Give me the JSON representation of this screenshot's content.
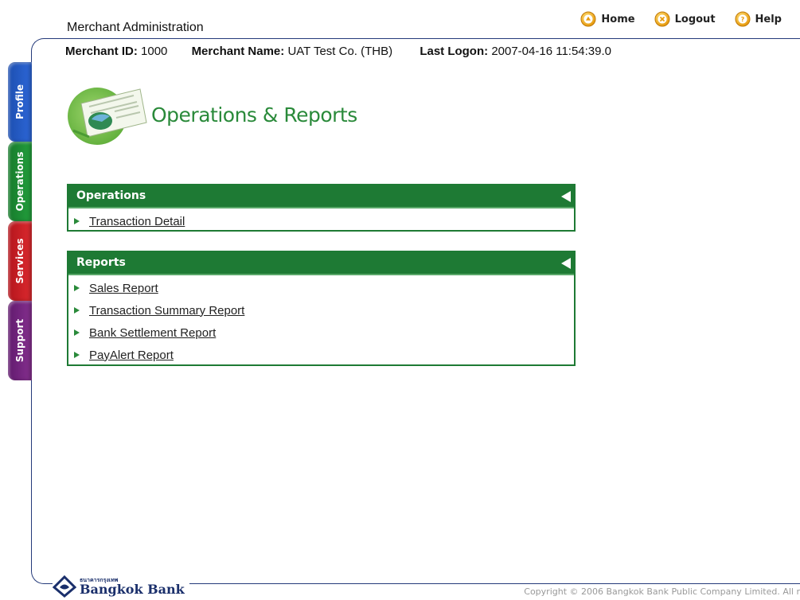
{
  "header": {
    "title": "Merchant Administration",
    "nav": [
      {
        "label": "Home",
        "icon": "home-icon"
      },
      {
        "label": "Logout",
        "icon": "logout-icon"
      },
      {
        "label": "Help",
        "icon": "help-icon"
      }
    ]
  },
  "merchant": {
    "id_label": "Merchant ID:",
    "id_value": "1000",
    "name_label": "Merchant Name:",
    "name_value": "UAT Test Co. (THB)",
    "logon_label": "Last Logon:",
    "logon_value": "2007-04-16 11:54:39.0"
  },
  "side_tabs": [
    {
      "label": "Profile",
      "color": "#1d4fb0"
    },
    {
      "label": "Operations",
      "color": "#177a2c"
    },
    {
      "label": "Services",
      "color": "#b3151c"
    },
    {
      "label": "Support",
      "color": "#611a6e"
    }
  ],
  "page": {
    "title": "Operations & Reports"
  },
  "operations": {
    "header": "Operations",
    "items": [
      "Transaction Detail"
    ]
  },
  "reports": {
    "header": "Reports",
    "items": [
      "Sales Report",
      "Transaction Summary Report",
      "Bank Settlement Report",
      "PayAlert Report"
    ]
  },
  "footer": {
    "bank_thai": "ธนาคารกรุงเทพ",
    "bank_name": "Bangkok Bank",
    "copyright": "Copyright © 2006 Bangkok Bank Public Company Limited. All r"
  },
  "colors": {
    "accent_green": "#1e7a34",
    "frame_blue": "#243a7a",
    "nav_icon_orange": "#f0a818"
  }
}
